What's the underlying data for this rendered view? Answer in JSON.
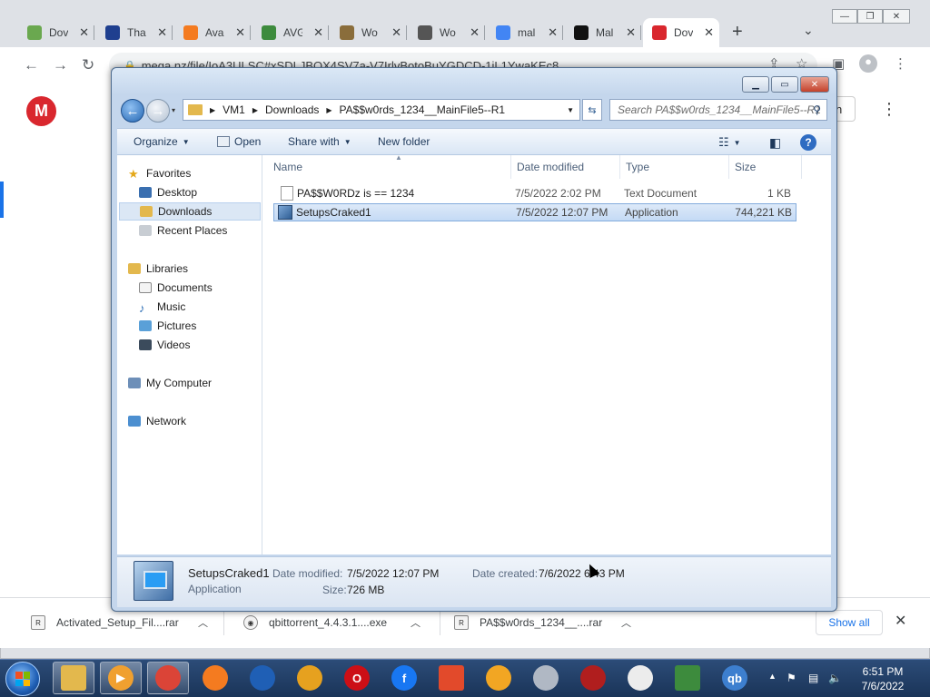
{
  "browser": {
    "tabs": [
      {
        "label": "Dov",
        "icon": "download-logo-icon",
        "color": "#6aa84f"
      },
      {
        "label": "Tha",
        "icon": "w-logo-icon",
        "color": "#1f3f8f"
      },
      {
        "label": "Ava",
        "icon": "avast-logo-icon",
        "color": "#f47b20"
      },
      {
        "label": "AVG",
        "icon": "avg-logo-icon",
        "color": "#3d8b3d"
      },
      {
        "label": "Wo",
        "icon": "castle-icon",
        "color": "#8a6d3b"
      },
      {
        "label": "Wo",
        "icon": "shield-logo-icon",
        "color": "#555555"
      },
      {
        "label": "mal",
        "icon": "google-logo-icon",
        "color": "#4285f4"
      },
      {
        "label": "Mal",
        "icon": "cs-logo-icon",
        "color": "#111111"
      },
      {
        "label": "Dov",
        "icon": "mega-logo-icon",
        "color": "#d9272e"
      }
    ],
    "url": "mega.nz/file/IoA3ULSC#xSDLJBOX4SV7a-V7IrlvBotoBuYGDCD-1iL1YwaKEc8",
    "page_button_label": "n"
  },
  "downloads": {
    "items": [
      {
        "name": "Activated_Setup_Fil....rar"
      },
      {
        "name": "qbittorrent_4.4.3.1....exe"
      },
      {
        "name": "PA$$w0rds_1234__....rar"
      }
    ],
    "show_all": "Show all"
  },
  "explorer": {
    "breadcrumb": [
      "VM1",
      "Downloads",
      "PA$$w0rds_1234__MainFile5--R1"
    ],
    "search_placeholder": "Search PA$$w0rds_1234__MainFile5--R1",
    "commands": {
      "organize": "Organize",
      "open": "Open",
      "share_with": "Share with",
      "new_folder": "New folder"
    },
    "nav": {
      "favorites": "Favorites",
      "desktop": "Desktop",
      "downloads": "Downloads",
      "recent_places": "Recent Places",
      "libraries": "Libraries",
      "documents": "Documents",
      "music": "Music",
      "pictures": "Pictures",
      "videos": "Videos",
      "my_computer": "My Computer",
      "network": "Network"
    },
    "columns": {
      "name": "Name",
      "date_modified": "Date modified",
      "type": "Type",
      "size": "Size"
    },
    "files": [
      {
        "name": "PA$$W0RDz is ==  1234",
        "date": "7/5/2022 2:02 PM",
        "type": "Text Document",
        "size": "1 KB"
      },
      {
        "name": "SetupsCraked1",
        "date": "7/5/2022 12:07 PM",
        "type": "Application",
        "size": "744,221 KB"
      }
    ],
    "details": {
      "name": "SetupsCraked1",
      "type": "Application",
      "date_modified_label": "Date modified:",
      "date_modified": "7/5/2022 12:07 PM",
      "size_label": "Size:",
      "size": "726 MB",
      "date_created_label": "Date created:",
      "date_created": "7/6/2022 6:43 PM"
    }
  },
  "taskbar": {
    "apps": [
      {
        "icon": "file-explorer-icon",
        "color": "#e3b84d",
        "glyph": ""
      },
      {
        "icon": "media-player-icon",
        "color": "#f0a030",
        "glyph": "▶"
      },
      {
        "icon": "chrome-icon",
        "color": "#db4437",
        "glyph": ""
      },
      {
        "icon": "avast-icon",
        "color": "#f47b20",
        "glyph": ""
      },
      {
        "icon": "shield-icon",
        "color": "#1f5fb5",
        "glyph": ""
      },
      {
        "icon": "browser-ring-icon",
        "color": "#e6a11f",
        "glyph": ""
      },
      {
        "icon": "opera-icon",
        "color": "#cc0f16",
        "glyph": "O"
      },
      {
        "icon": "facebook-icon",
        "color": "#1877f2",
        "glyph": "f"
      },
      {
        "icon": "office-icon",
        "color": "#e24a2b",
        "glyph": ""
      },
      {
        "icon": "avira-icon",
        "color": "#f2a623",
        "glyph": ""
      },
      {
        "icon": "system-tool-icon",
        "color": "#b0b8c4",
        "glyph": ""
      },
      {
        "icon": "secure-browser-icon",
        "color": "#b01e1e",
        "glyph": ""
      },
      {
        "icon": "hat-icon",
        "color": "#ececec",
        "glyph": ""
      },
      {
        "icon": "avg-icon",
        "color": "#3d8b3d",
        "glyph": ""
      },
      {
        "icon": "qbittorrent-icon",
        "color": "#3d7fcf",
        "glyph": "qb"
      }
    ],
    "clock": {
      "time": "6:51 PM",
      "date": "7/6/2022"
    }
  }
}
